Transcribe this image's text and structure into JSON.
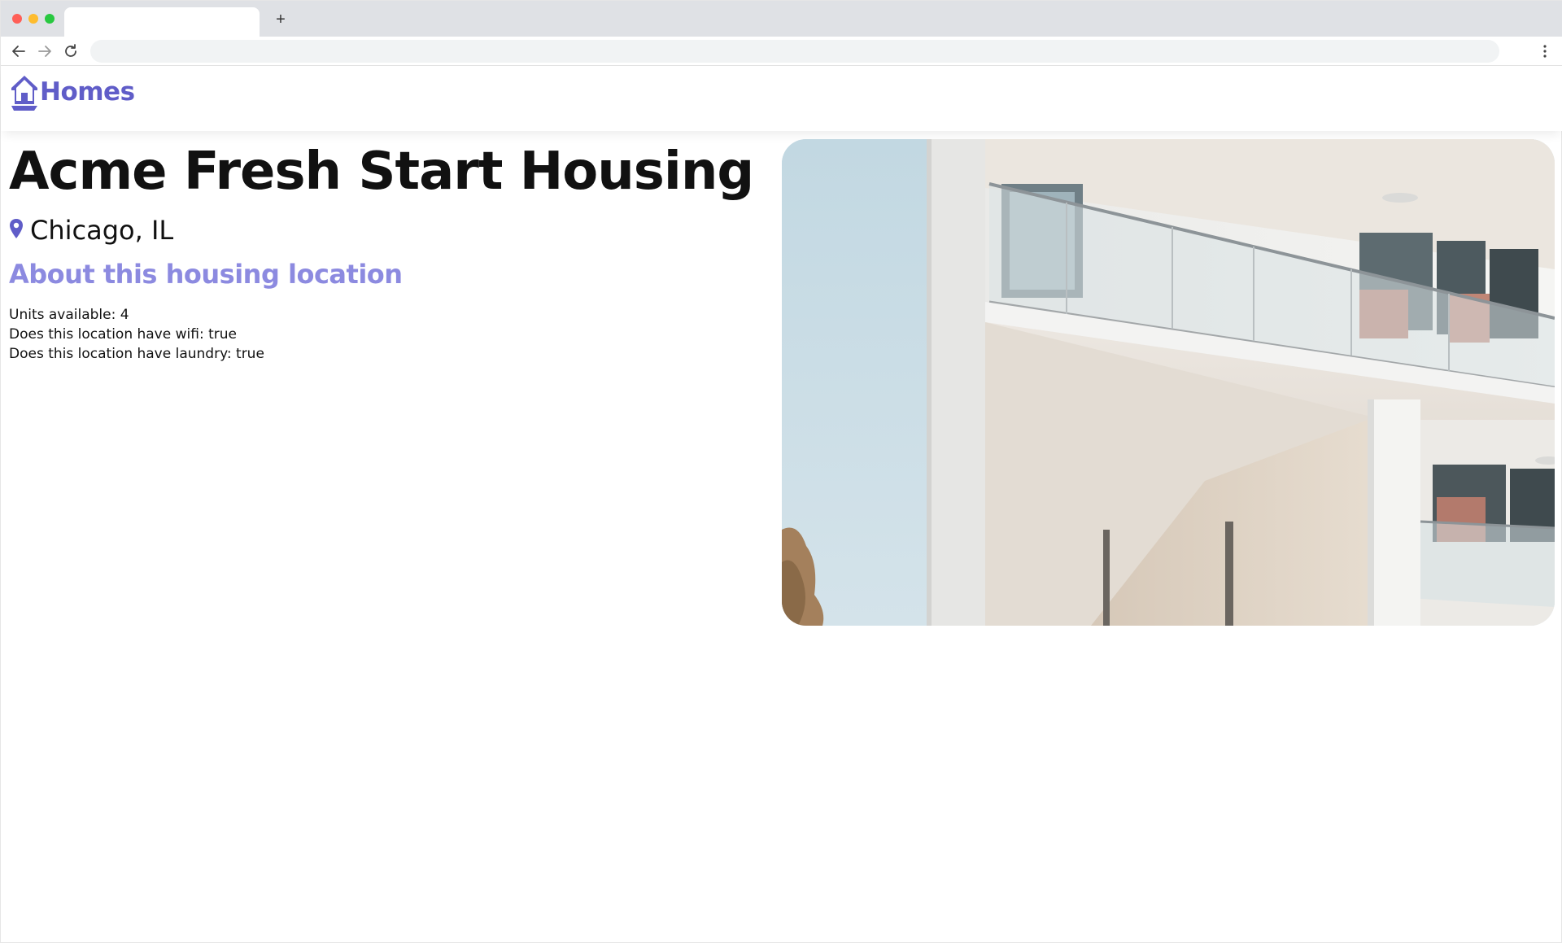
{
  "browser": {
    "tab_title": "",
    "address": "",
    "new_tab_label": "+"
  },
  "header": {
    "brand_label": "Homes",
    "brand_icon": "house-icon",
    "accent_color": "#605DC8"
  },
  "listing": {
    "title": "Acme Fresh Start Housing",
    "location_icon": "map-pin-icon",
    "location": "Chicago, IL",
    "section_heading": "About this housing location",
    "heading_color": "#8C8AE0",
    "facts": [
      "Units available: 4",
      "Does this location have wifi: true",
      "Does this location have laundry: true"
    ],
    "photo_alt": ""
  }
}
